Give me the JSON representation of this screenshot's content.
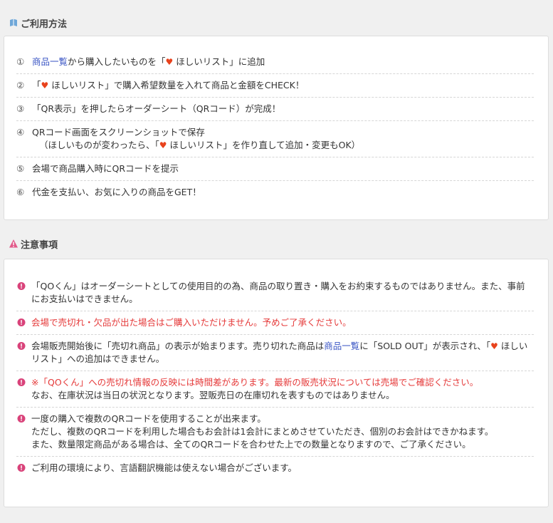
{
  "usage": {
    "title": "ご利用方法",
    "steps": [
      {
        "num": "①",
        "link": "商品一覧",
        "a": "から購入したいものを「",
        "heart": "♥",
        "b": " ほしいリスト」に追加"
      },
      {
        "num": "②",
        "a": "「",
        "heart": "♥",
        "b": " ほしいリスト」で購入希望数量を入れて商品と金額をCHECK！"
      },
      {
        "num": "③",
        "a": "「QR表示」を押したらオーダーシート（QRコード）が完成！"
      },
      {
        "num": "④",
        "a": "QRコード画面をスクリーンショットで保存",
        "line2a": "（ほしいものが変わったら、「",
        "heart": "♥",
        "line2b": " ほしいリスト」を作り直して追加・変更もOK）"
      },
      {
        "num": "⑤",
        "a": "会場で商品購入時にQRコードを提示"
      },
      {
        "num": "⑥",
        "a": "代金を支払い、お気に入りの商品をGET！"
      }
    ]
  },
  "notes": {
    "title": "注意事項",
    "items": [
      {
        "a": "「QOくん」はオーダーシートとしての使用目的の為、商品の取り置き・購入をお約束するものではありません。また、事前にお支払いはできません。"
      },
      {
        "a": "会場で売切れ・欠品が出た場合はご購入いただけません。予めご了承ください。"
      },
      {
        "a": "会場販売開始後に「売切れ商品」の表示が始まります。売り切れた商品は",
        "link": "商品一覧",
        "b": "に「SOLD OUT」が表示され、「",
        "heart": "♥",
        "c": " ほしいリスト」への追加はできません。"
      },
      {
        "a": "※「QOくん」への売切れ情報の反映には時間差があります。最新の販売状況については売場でご確認ください。",
        "line2": "なお、在庫状況は当日の状況となります。翌販売日の在庫切れを表すものではありません。"
      },
      {
        "a": "一度の購入で複数のQRコードを使用することが出来ます。",
        "line2": "ただし、複数のQRコードを利用した場合もお会計は1会計にまとめさせていただき、個別のお会計はできかねます。",
        "line3": "また、数量限定商品がある場合は、全てのQRコードを合わせた上での数量となりますので、ご了承ください。"
      },
      {
        "a": "ご利用の環境により、言語翻訳機能は使えない場合がございます。"
      }
    ]
  },
  "colors": {
    "accent_link": "#3b56c4",
    "heart": "#e8421c",
    "warning_text": "#e53a3a",
    "note_icon": "#d9437a"
  }
}
